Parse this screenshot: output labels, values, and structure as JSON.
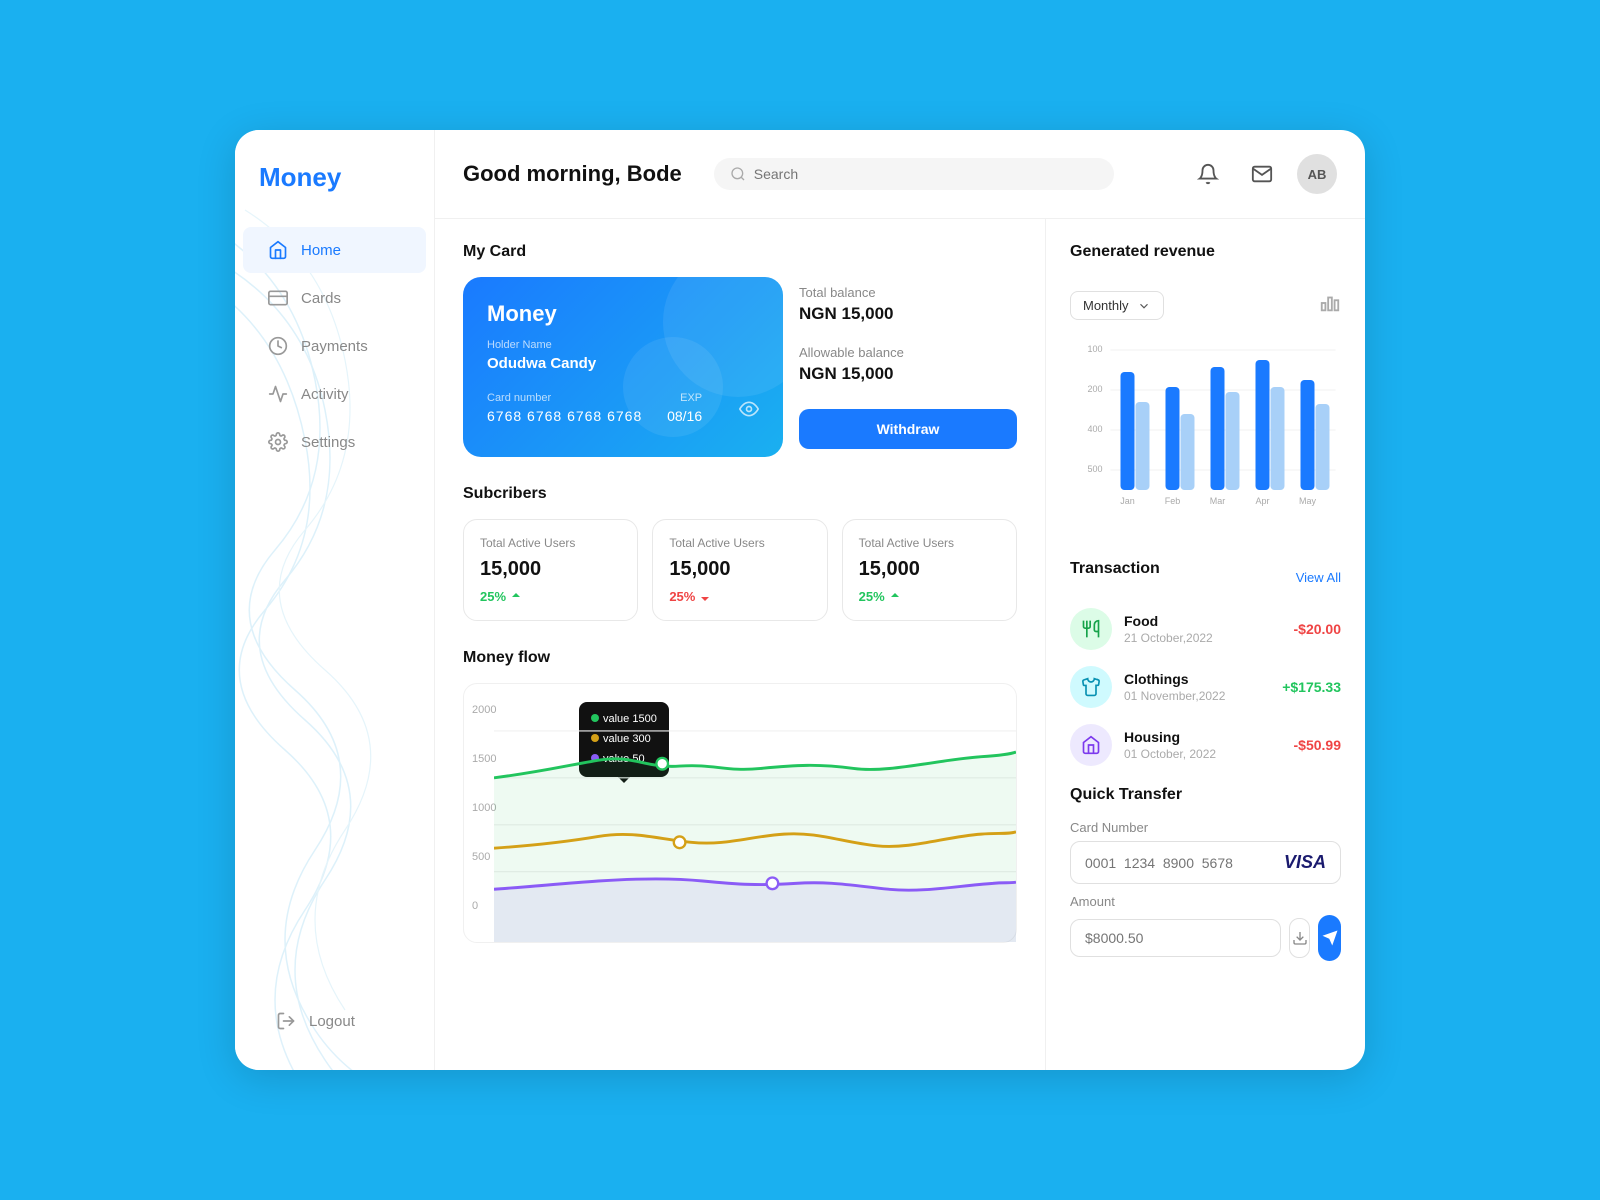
{
  "app": {
    "title": "Money",
    "greeting": "Good morning, Bode"
  },
  "search": {
    "placeholder": "Search"
  },
  "header_icons": {
    "notification": "🔔",
    "message": "✉",
    "avatar_initials": "AB"
  },
  "sidebar": {
    "items": [
      {
        "label": "Home",
        "icon": "home",
        "active": true
      },
      {
        "label": "Cards",
        "icon": "card",
        "active": false
      },
      {
        "label": "Payments",
        "icon": "payments",
        "active": false
      },
      {
        "label": "Activity",
        "icon": "activity",
        "active": false
      },
      {
        "label": "Settings",
        "icon": "settings",
        "active": false
      },
      {
        "label": "Logout",
        "icon": "logout",
        "active": false
      }
    ]
  },
  "my_card": {
    "title": "My Card",
    "card": {
      "brand": "Money",
      "holder_label": "Holder Name",
      "holder_name": "Odudwa Candy",
      "number_label": "Card number",
      "number": "6768  6768  6768  6768",
      "exp_label": "EXP",
      "exp": "08/16"
    },
    "balance": {
      "total_label": "Total balance",
      "total_amount": "NGN 15,000",
      "allowable_label": "Allowable balance",
      "allowable_amount": "NGN 15,000",
      "withdraw_label": "Withdraw"
    }
  },
  "subscribers": {
    "title": "Subcribers",
    "cards": [
      {
        "label": "Total Active Users",
        "value": "15,000",
        "change": "25%",
        "direction": "up"
      },
      {
        "label": "Total Active Users",
        "value": "15,000",
        "change": "25%",
        "direction": "down"
      },
      {
        "label": "Total Active Users",
        "value": "15,000",
        "change": "25%",
        "direction": "up"
      }
    ]
  },
  "money_flow": {
    "title": "Money flow",
    "y_labels": [
      "2000",
      "1500",
      "1000",
      "500",
      "0"
    ],
    "tooltip": {
      "line1": "value  1500",
      "line2": "value  300",
      "line3": "value  50",
      "colors": [
        "#22c55e",
        "#d4a017",
        "#8b5cf6"
      ]
    }
  },
  "generated_revenue": {
    "title": "Generated revenue",
    "period": "Monthly",
    "months": [
      "Jan",
      "Feb",
      "Mar",
      "Apr",
      "May"
    ],
    "y_labels": [
      "100",
      "200",
      "400",
      "500"
    ],
    "bars": [
      {
        "month": "Jan",
        "dark": 65,
        "light": 45
      },
      {
        "month": "Feb",
        "dark": 55,
        "light": 35
      },
      {
        "month": "Mar",
        "dark": 70,
        "light": 50
      },
      {
        "month": "Apr",
        "dark": 75,
        "light": 55
      },
      {
        "month": "May",
        "dark": 60,
        "light": 40
      }
    ]
  },
  "transactions": {
    "title": "Transaction",
    "view_all": "View All",
    "items": [
      {
        "name": "Food",
        "date": "21 October,2022",
        "amount": "-$20.00",
        "type": "negative",
        "icon_bg": "#dcfce7",
        "icon_color": "#16a34a",
        "icon": "🏠"
      },
      {
        "name": "Clothings",
        "date": "01 November,2022",
        "amount": "+$175.33",
        "type": "positive",
        "icon_bg": "#cffafe",
        "icon_color": "#0891b2",
        "icon": "👕"
      },
      {
        "name": "Housing",
        "date": "01 October, 2022",
        "amount": "-$50.99",
        "type": "negative",
        "icon_bg": "#ede9fe",
        "icon_color": "#7c3aed",
        "icon": "🏠"
      }
    ]
  },
  "quick_transfer": {
    "title": "Quick Transfer",
    "card_number_label": "Card Number",
    "card_number_placeholder": "0001  1234  8900  5678",
    "card_network": "VISA",
    "amount_label": "Amount",
    "amount_placeholder": "$8000.50"
  }
}
